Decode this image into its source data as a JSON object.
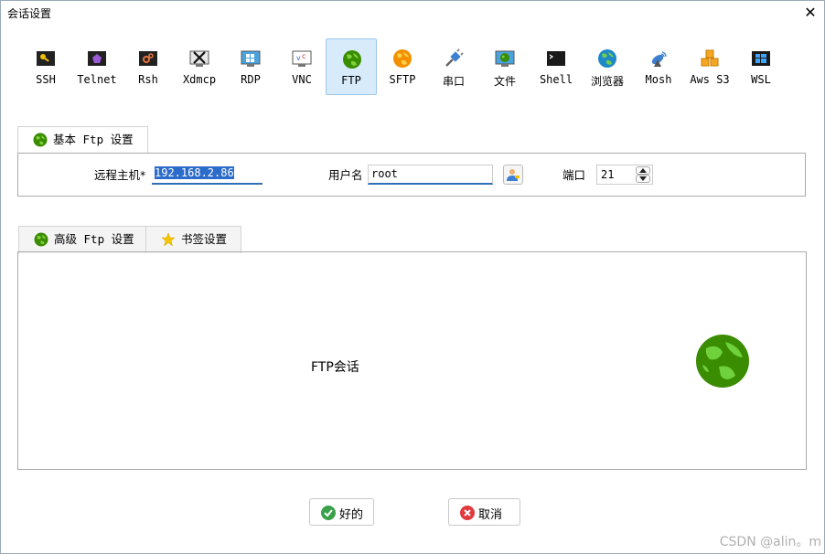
{
  "window": {
    "title": "会话设置"
  },
  "protocols": [
    {
      "label": "SSH",
      "icon": "key-icon"
    },
    {
      "label": "Telnet",
      "icon": "telnet-icon"
    },
    {
      "label": "Rsh",
      "icon": "rsh-icon"
    },
    {
      "label": "Xdmcp",
      "icon": "xdmcp-icon"
    },
    {
      "label": "RDP",
      "icon": "rdp-icon"
    },
    {
      "label": "VNC",
      "icon": "vnc-icon"
    },
    {
      "label": "FTP",
      "icon": "globe-icon",
      "selected": true
    },
    {
      "label": "SFTP",
      "icon": "sftp-globe-icon"
    },
    {
      "label": "串口",
      "icon": "serial-plug-icon"
    },
    {
      "label": "文件",
      "icon": "file-monitor-icon"
    },
    {
      "label": "Shell",
      "icon": "shell-terminal-icon"
    },
    {
      "label": "浏览器",
      "icon": "browser-globe-icon"
    },
    {
      "label": "Mosh",
      "icon": "satellite-icon"
    },
    {
      "label": "Aws S3",
      "icon": "aws-cubes-icon"
    },
    {
      "label": "WSL",
      "icon": "windows-icon"
    }
  ],
  "basic": {
    "tab_label": "基本 Ftp 设置",
    "host_label": "远程主机*",
    "host_value": "192.168.2.86",
    "user_label": "用户名",
    "user_value": "root",
    "port_label": "端口",
    "port_value": "21"
  },
  "advanced": {
    "tab_label": "高级 Ftp 设置",
    "bookmark_tab_label": "书签设置",
    "session_text": "FTP会话"
  },
  "buttons": {
    "ok": "好的",
    "cancel": "取消"
  },
  "watermark": "CSDN @alin。m",
  "colors": {
    "accent": "#2b6bc9",
    "selected_bg": "#d7ebfb",
    "globe_green": "#3a8c00"
  }
}
